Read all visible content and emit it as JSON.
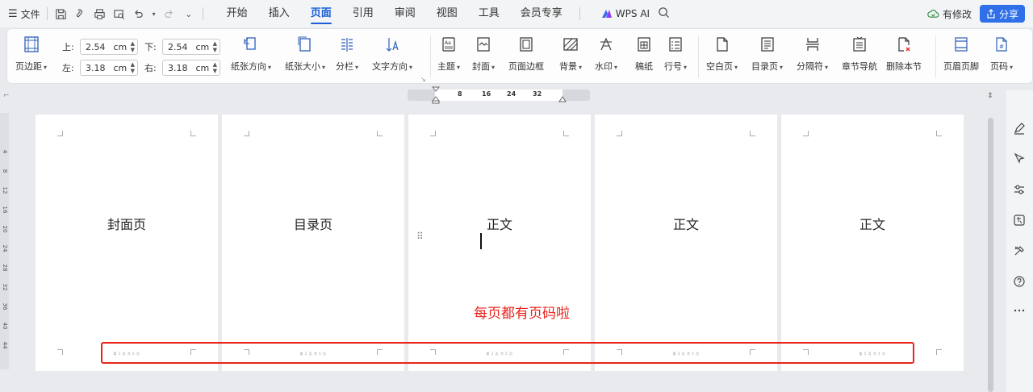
{
  "menubar": {
    "file_label": "文件",
    "tabs": [
      "开始",
      "插入",
      "页面",
      "引用",
      "审阅",
      "视图",
      "工具",
      "会员专享"
    ],
    "active_tab": "页面",
    "wps_ai_label": "WPS AI",
    "modified_label": "有修改",
    "share_label": "分享"
  },
  "ribbon": {
    "margin_button": "页边距",
    "margins": {
      "top_label": "上:",
      "top_value": "2.54",
      "bottom_label": "下:",
      "bottom_value": "2.54",
      "left_label": "左:",
      "left_value": "3.18",
      "right_label": "右:",
      "right_value": "3.18",
      "unit": "cm"
    },
    "orientation": "纸张方向",
    "paper_size": "纸张大小",
    "columns": "分栏",
    "text_direction": "文字方向",
    "theme": "主题",
    "cover": "封面",
    "page_border": "页面边框",
    "background": "背景",
    "watermark": "水印",
    "manuscript": "稿纸",
    "line_number": "行号",
    "blank_page": "空白页",
    "toc_page": "目录页",
    "separator": "分隔符",
    "chapter_nav": "章节导航",
    "delete_section": "删除本节",
    "header_footer": "页眉页脚",
    "page_number": "页码"
  },
  "ruler": {
    "ticks": [
      "8",
      "16",
      "24",
      "32"
    ]
  },
  "vruler": {
    "ticks": [
      "4",
      "8",
      "12",
      "16",
      "20",
      "24",
      "28",
      "32",
      "36",
      "40",
      "44"
    ]
  },
  "pages": [
    {
      "title": "封面页",
      "footer": "第 1 页 共 5 页"
    },
    {
      "title": "目录页",
      "footer": "第 2 页 共 5 页"
    },
    {
      "title": "正文",
      "footer": "第 3 页 共 5 页"
    },
    {
      "title": "正文",
      "footer": "第 4 页 共 5 页"
    },
    {
      "title": "正文",
      "footer": "第 5 页 共 5 页"
    }
  ],
  "annotation": {
    "text": "每页都有页码啦",
    "color": "#e8241c"
  },
  "colors": {
    "accent": "#1a5fd9",
    "share": "#2f6fe8"
  }
}
